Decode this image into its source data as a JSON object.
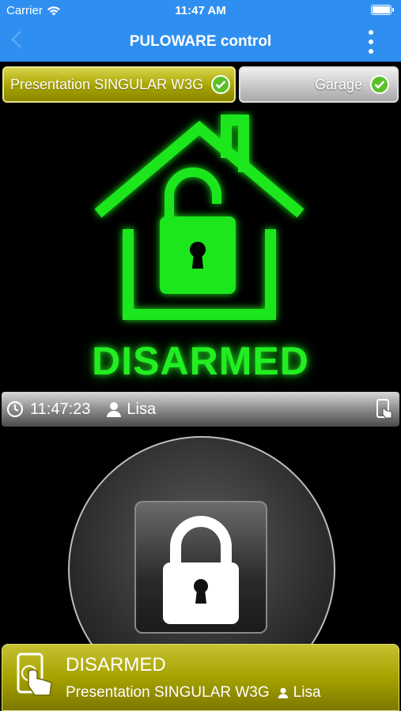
{
  "status_bar": {
    "carrier": "Carrier",
    "time": "11:47 AM"
  },
  "nav": {
    "title": "PULOWARE control"
  },
  "tabs": [
    {
      "label": "Presentation SINGULAR W3G",
      "active": true
    },
    {
      "label": "Garage",
      "active": false
    }
  ],
  "state": {
    "label": "DISARMED",
    "color": "#22ee22"
  },
  "event": {
    "time": "11:47:23",
    "user": "Lisa"
  },
  "banner": {
    "title": "DISARMED",
    "device": "Presentation SINGULAR W3G",
    "user": "Lisa"
  },
  "colors": {
    "nav": "#2f8ff0",
    "accent_green": "#22ee22",
    "active_tab": "#a8a400",
    "check": "#5bbf2a"
  },
  "icons": {
    "wifi": "wifi-icon",
    "battery": "battery-icon",
    "back": "chevron-left-icon",
    "more": "more-vertical-icon",
    "check": "check-circle-icon",
    "clock": "clock-icon",
    "user": "user-icon",
    "touch": "touch-phone-icon",
    "lock": "lock-icon",
    "house": "house-unlocked-icon"
  }
}
